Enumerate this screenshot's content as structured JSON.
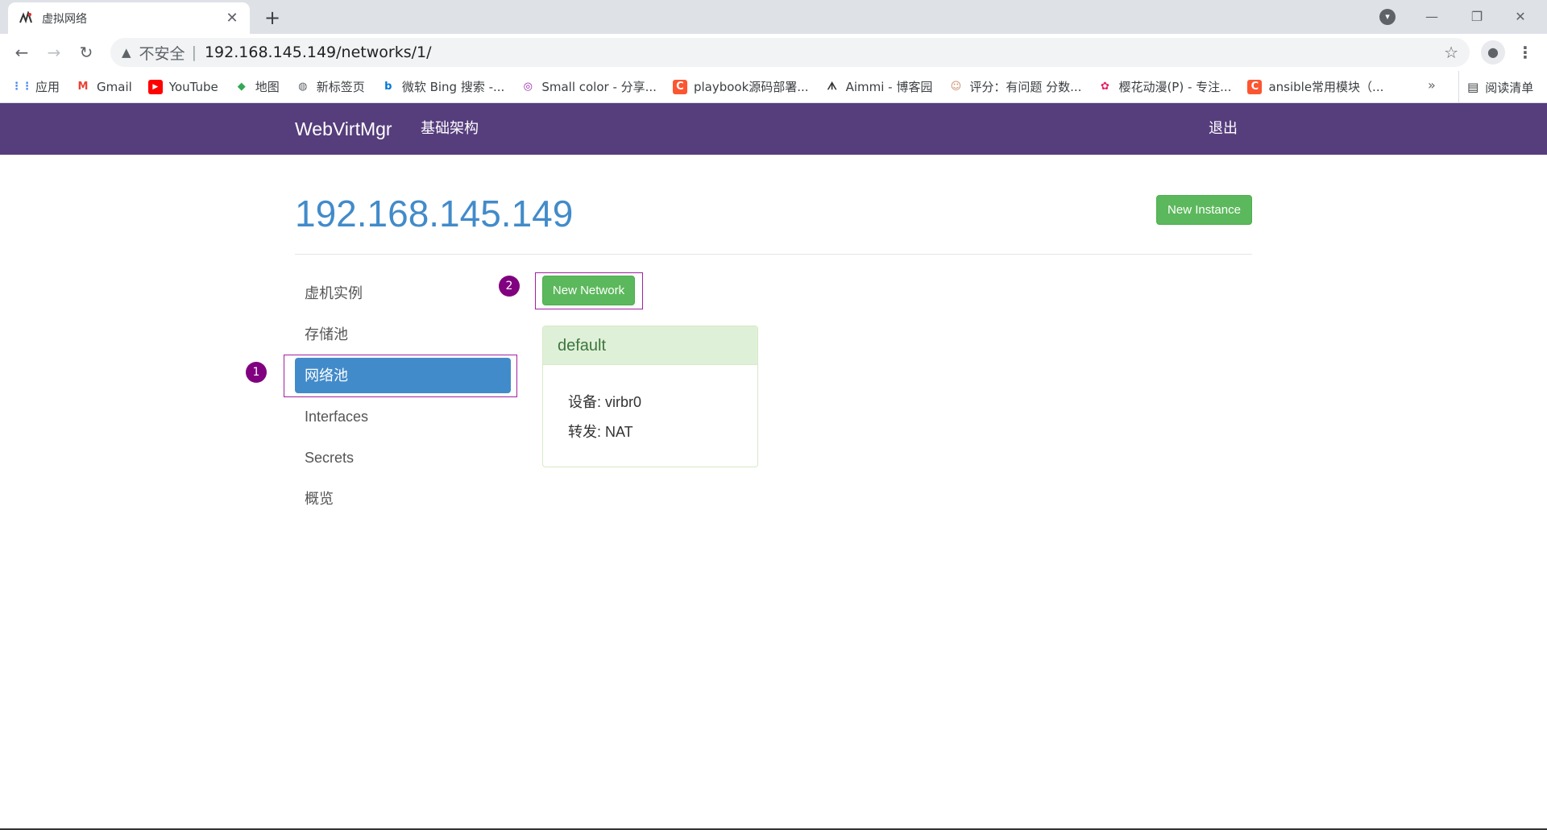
{
  "browser": {
    "tab_title": "虚拟网络",
    "tab_close": "✕",
    "new_tab": "+",
    "omnibox": {
      "security_label": "不安全",
      "separator": "|",
      "url": "192.168.145.149/networks/1/"
    },
    "bookmarks": [
      {
        "label": "应用",
        "icon": "apps-grid-icon",
        "color": "#4285f4"
      },
      {
        "label": "Gmail",
        "icon": "gmail-icon",
        "color": "#ea4335"
      },
      {
        "label": "YouTube",
        "icon": "youtube-icon",
        "color": "#ff0000"
      },
      {
        "label": "地图",
        "icon": "maps-icon",
        "color": "#34a853"
      },
      {
        "label": "新标签页",
        "icon": "globe-icon",
        "color": "#5f6368"
      },
      {
        "label": "微软 Bing 搜索 -...",
        "icon": "bing-icon",
        "color": "#0078d4"
      },
      {
        "label": "Small color - 分享...",
        "icon": "smallcolor-icon",
        "color": "#9c27b0"
      },
      {
        "label": "playbook源码部署...",
        "icon": "csdn-icon",
        "color": "#fc5531"
      },
      {
        "label": "Aimmi - 博客园",
        "icon": "cnblogs-icon",
        "color": "#333333"
      },
      {
        "label": "评分：有问题 分数...",
        "icon": "avatar-icon",
        "color": "#c98b6b"
      },
      {
        "label": "樱花动漫(P) - 专注...",
        "icon": "sakura-icon",
        "color": "#e91e63"
      },
      {
        "label": "ansible常用模块（...",
        "icon": "csdn-icon",
        "color": "#fc5531"
      }
    ],
    "bookmarks_more": "»",
    "reading_list": "阅读清单"
  },
  "app": {
    "brand": "WebVirtMgr",
    "nav_infrastructure": "基础架构",
    "nav_logout": "退出",
    "accent_color": "#563d7c",
    "host_title": "192.168.145.149",
    "new_instance_label": "New Instance",
    "new_network_label": "New Network",
    "sidebar": [
      {
        "label": "虚机实例",
        "active": false
      },
      {
        "label": "存储池",
        "active": false
      },
      {
        "label": "网络池",
        "active": true
      },
      {
        "label": "Interfaces",
        "active": false
      },
      {
        "label": "Secrets",
        "active": false
      },
      {
        "label": "概览",
        "active": false
      }
    ],
    "network_panel": {
      "name": "default",
      "device_line": "设备: virbr0",
      "forward_line": "转发: NAT"
    },
    "annotations": {
      "badge_1": "1",
      "badge_2": "2"
    }
  }
}
